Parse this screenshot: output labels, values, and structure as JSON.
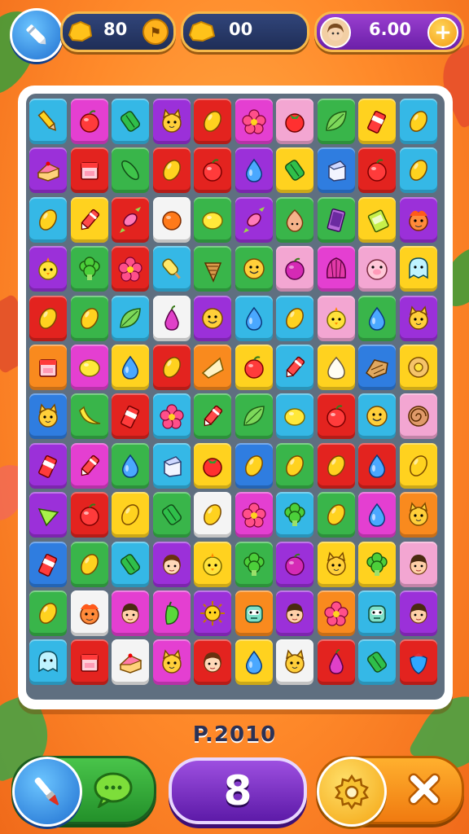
{
  "hud": {
    "coins_left": "80",
    "coins_mid": "00",
    "coins_right": "6.00"
  },
  "bottom": {
    "score_label": "P.2010",
    "level_number": "8"
  },
  "colors": {
    "green": "#39b54a",
    "magenta": "#e43fd1",
    "cyan": "#35b8e6",
    "purple": "#9b30d9",
    "red": "#e3231f",
    "yellow": "#ffd21f",
    "blue": "#2f7de0",
    "orange": "#f98a1e",
    "pink": "#f3a6d2",
    "white": "#f4f4f4"
  },
  "board": {
    "rows": [
      [
        [
          "cyan",
          "pencil-icon"
        ],
        [
          "magenta",
          "apple-icon"
        ],
        [
          "cyan",
          "leaf-candy-icon"
        ],
        [
          "purple",
          "cat-face-icon"
        ],
        [
          "red",
          "bean-icon"
        ],
        [
          "magenta",
          "flower-icon"
        ],
        [
          "pink",
          "tomato-icon"
        ],
        [
          "green",
          "leaf-icon"
        ],
        [
          "yellow",
          "drink-cup-icon"
        ],
        [
          "cyan",
          "bean-icon"
        ]
      ],
      [
        [
          "purple",
          "cake-icon"
        ],
        [
          "red",
          "box-icon"
        ],
        [
          "green",
          "cucumber-icon"
        ],
        [
          "red",
          "bean-icon"
        ],
        [
          "red",
          "apple-icon"
        ],
        [
          "purple",
          "drop-icon"
        ],
        [
          "yellow",
          "leaf-candy-icon"
        ],
        [
          "blue",
          "milk-box-icon"
        ],
        [
          "red",
          "apple-icon"
        ],
        [
          "cyan",
          "bean-icon"
        ]
      ],
      [
        [
          "cyan",
          "bean-icon"
        ],
        [
          "yellow",
          "crayon-icon"
        ],
        [
          "red",
          "wrapped-candy-icon"
        ],
        [
          "white",
          "orange-icon"
        ],
        [
          "green",
          "lemon-icon"
        ],
        [
          "purple",
          "wrapped-candy-icon"
        ],
        [
          "green",
          "onion-icon"
        ],
        [
          "green",
          "phone-icon"
        ],
        [
          "yellow",
          "juice-box-icon"
        ],
        [
          "purple",
          "monster-icon"
        ]
      ],
      [
        [
          "purple",
          "chick-icon"
        ],
        [
          "green",
          "broccoli-icon"
        ],
        [
          "red",
          "flower-icon"
        ],
        [
          "cyan",
          "popsicle-icon"
        ],
        [
          "green",
          "cone-icon"
        ],
        [
          "green",
          "smile-face-icon"
        ],
        [
          "pink",
          "plum-icon"
        ],
        [
          "magenta",
          "shell-icon"
        ],
        [
          "pink",
          "pig-face-icon"
        ],
        [
          "yellow",
          "ghost-face-icon"
        ]
      ],
      [
        [
          "red",
          "bean-icon"
        ],
        [
          "green",
          "bean-icon"
        ],
        [
          "cyan",
          "leaf-icon"
        ],
        [
          "white",
          "pear-icon"
        ],
        [
          "purple",
          "smile-face-icon"
        ],
        [
          "cyan",
          "drop-icon"
        ],
        [
          "cyan",
          "bean-icon"
        ],
        [
          "pink",
          "chick-icon"
        ],
        [
          "green",
          "drop-icon"
        ],
        [
          "purple",
          "cat-face-icon"
        ]
      ],
      [
        [
          "orange",
          "box-icon"
        ],
        [
          "magenta",
          "lemon-icon"
        ],
        [
          "yellow",
          "drop-icon"
        ],
        [
          "red",
          "bean-icon"
        ],
        [
          "orange",
          "cheese-icon"
        ],
        [
          "yellow",
          "apple-icon"
        ],
        [
          "cyan",
          "crayon-icon"
        ],
        [
          "yellow",
          "garlic-icon"
        ],
        [
          "blue",
          "bread-icon"
        ],
        [
          "yellow",
          "donut-icon"
        ]
      ],
      [
        [
          "blue",
          "cat-face-icon"
        ],
        [
          "green",
          "banana-icon"
        ],
        [
          "red",
          "drink-cup-icon"
        ],
        [
          "cyan",
          "flower-icon"
        ],
        [
          "green",
          "crayon-icon"
        ],
        [
          "green",
          "leaf-icon"
        ],
        [
          "cyan",
          "lemon-icon"
        ],
        [
          "red",
          "apple-icon"
        ],
        [
          "cyan",
          "smile-face-icon"
        ],
        [
          "pink",
          "snail-icon"
        ]
      ],
      [
        [
          "purple",
          "drink-cup-icon"
        ],
        [
          "magenta",
          "crayon-icon"
        ],
        [
          "green",
          "drop-icon"
        ],
        [
          "cyan",
          "milk-box-icon"
        ],
        [
          "yellow",
          "tomato-icon"
        ],
        [
          "blue",
          "bean-icon"
        ],
        [
          "green",
          "bean-icon"
        ],
        [
          "red",
          "bean-icon"
        ],
        [
          "red",
          "drop-icon"
        ],
        [
          "yellow",
          "bean-icon"
        ]
      ],
      [
        [
          "purple",
          "triangle-candy-icon"
        ],
        [
          "red",
          "apple-icon"
        ],
        [
          "yellow",
          "bean-icon"
        ],
        [
          "green",
          "leaf-candy-icon"
        ],
        [
          "white",
          "bean-icon"
        ],
        [
          "magenta",
          "flower-icon"
        ],
        [
          "cyan",
          "broccoli-icon"
        ],
        [
          "green",
          "bean-icon"
        ],
        [
          "magenta",
          "drop-icon"
        ],
        [
          "orange",
          "cat-face-icon"
        ]
      ],
      [
        [
          "blue",
          "drink-cup-icon"
        ],
        [
          "green",
          "bean-icon"
        ],
        [
          "cyan",
          "leaf-candy-icon"
        ],
        [
          "purple",
          "girl-face-icon"
        ],
        [
          "yellow",
          "chick-icon"
        ],
        [
          "green",
          "broccoli-icon"
        ],
        [
          "purple",
          "plum-icon"
        ],
        [
          "yellow",
          "cat-face-icon"
        ],
        [
          "yellow",
          "broccoli-icon"
        ],
        [
          "pink",
          "boy-face-icon"
        ]
      ],
      [
        [
          "green",
          "bean-icon"
        ],
        [
          "white",
          "monster-icon"
        ],
        [
          "magenta",
          "boy-face-icon"
        ],
        [
          "magenta",
          "pepper-icon"
        ],
        [
          "purple",
          "sun-face-icon"
        ],
        [
          "orange",
          "robot-face-icon"
        ],
        [
          "purple",
          "boy-face-icon"
        ],
        [
          "orange",
          "flower-icon"
        ],
        [
          "cyan",
          "robot-face-icon"
        ],
        [
          "purple",
          "boy-face-icon"
        ]
      ],
      [
        [
          "cyan",
          "ghost-face-icon"
        ],
        [
          "red",
          "box-icon"
        ],
        [
          "white",
          "cake-icon"
        ],
        [
          "magenta",
          "cat-face-icon"
        ],
        [
          "red",
          "girl-face-icon"
        ],
        [
          "yellow",
          "drop-icon"
        ],
        [
          "white",
          "cat-face-icon"
        ],
        [
          "red",
          "pear-icon"
        ],
        [
          "cyan",
          "leaf-candy-icon"
        ],
        [
          "red",
          "strawberry-icon"
        ]
      ]
    ]
  }
}
